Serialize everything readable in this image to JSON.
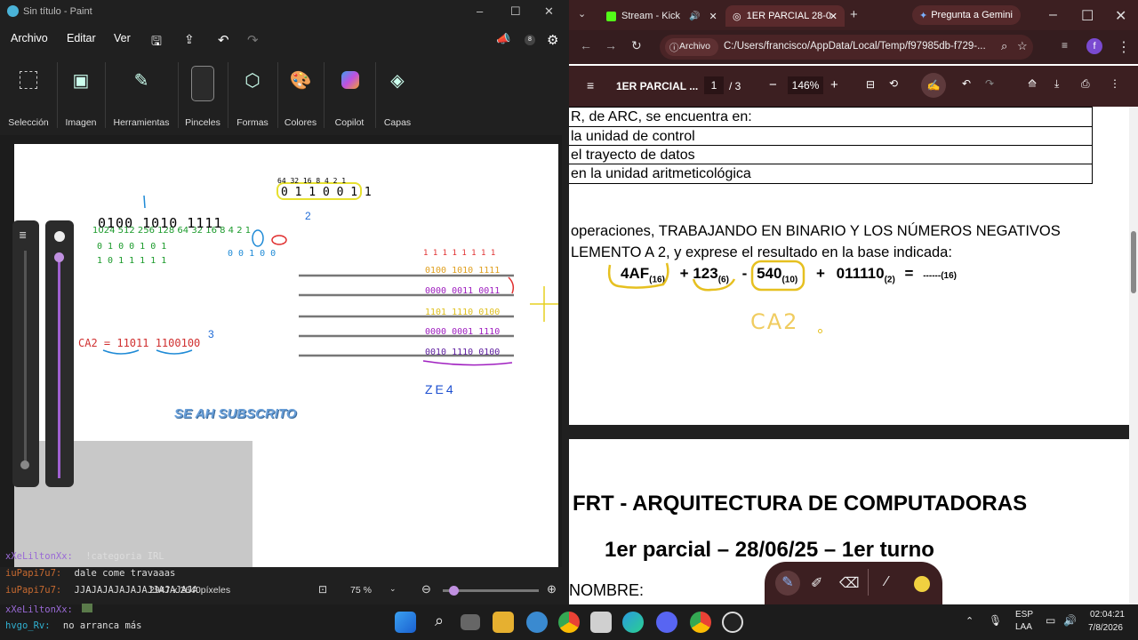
{
  "paint": {
    "window_title": "Sin título - Paint",
    "menu": [
      "Archivo",
      "Editar",
      "Ver"
    ],
    "ribbon": [
      "Selección",
      "Imagen",
      "Herramientas",
      "Pinceles",
      "Formas",
      "Colores",
      "Copilot",
      "Capas"
    ],
    "canvas_texts": {
      "subscribed": "SE AH SUBSCRITO",
      "bin1": "0100 1010 1111",
      "ca2": "CA2 = 11011 1100100",
      "ze4": "ZE4"
    },
    "status": {
      "dimensions": "2947 x 2640píxeles",
      "zoom": "75 %"
    }
  },
  "chat": [
    {
      "user": "xXeLiltonXx:",
      "msg": "!categoria IRL"
    },
    {
      "user": "iuPapi7u7:",
      "msg": "dale come travaaas"
    },
    {
      "user": "iuPapi7u7:",
      "msg": "JJAJAJAJAJAJAJJAJAJAJA"
    },
    {
      "user": "xXeLiltonXx:",
      "msg": ""
    },
    {
      "user": "hvgo_Rv:",
      "msg": "no arranca más"
    }
  ],
  "browser": {
    "tabs": [
      "Stream - Kick",
      "1ER PARCIAL 28-0"
    ],
    "gemini": "Pregunta a Gemini",
    "address_chip": "Archivo",
    "url": "C:/Users/francisco/AppData/Local/Temp/f97985db-f729-...",
    "avatar": "f",
    "pdf": {
      "title": "1ER PARCIAL ...",
      "page": "1",
      "page_total": "/ 3",
      "zoom": "146%"
    }
  },
  "document": {
    "table_rows": [
      "R, de ARC, se encuentra en:",
      "la unidad de control",
      "el trayecto de datos",
      "en la unidad aritmeticológica"
    ],
    "q_line1": "operaciones, TRABAJANDO EN BINARIO Y LOS NÚMEROS NEGATIVOS",
    "q_line2": "LEMENTO A 2, y exprese el resultado en la base indicada:",
    "expr": {
      "t1": "4AF",
      "s1": "(16)",
      "op1": "+",
      "t2": "123",
      "s2": "(6)",
      "op2": "-",
      "t3": "540",
      "s3": "(10)",
      "op3": "+",
      "t4": "011110",
      "s4": "(2)",
      "eq": "=",
      "ans": "------",
      "s5": "(16)"
    },
    "handwritten": "CA2",
    "heading": "FRT - ARQUITECTURA DE COMPUTADORAS",
    "subheading": "1er parcial – 28/06/25 – 1er turno",
    "name_label": "NOMBRE:"
  },
  "taskbar": {
    "lang": "ESP",
    "lang2": "LAA",
    "time": "02:04:21",
    "date": "7/8/2026"
  }
}
